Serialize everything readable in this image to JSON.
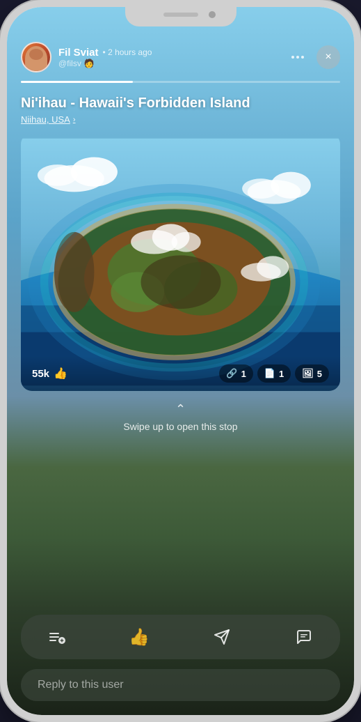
{
  "phone": {
    "notch": {
      "has_speaker": true,
      "has_camera": true
    }
  },
  "header": {
    "username": "Fil Sviat",
    "handle": "@filsv",
    "emoji": "🧑",
    "time_ago": "• 2 hours ago",
    "dots_label": "more options",
    "close_label": "×"
  },
  "progress": {
    "fill_percent": 35
  },
  "post": {
    "title": "Ni'ihau - Hawaii's Forbidden Island",
    "location": "Niihau, USA",
    "location_arrow": "›"
  },
  "image": {
    "alt": "Aerial view of Niihau island, Hawaii",
    "likes": "55k",
    "likes_icon": "👍",
    "pills": [
      {
        "count": "1",
        "icon": "🔗",
        "label": "link"
      },
      {
        "count": "1",
        "icon": "📄",
        "label": "document"
      },
      {
        "count": "5",
        "icon": "🖼",
        "label": "images"
      }
    ]
  },
  "swipe": {
    "chevron": "⌃",
    "text": "Swipe up to open this stop"
  },
  "action_bar": {
    "buttons": [
      {
        "id": "add-list",
        "icon": "≡+",
        "label": "add to list"
      },
      {
        "id": "like",
        "icon": "👍",
        "label": "like"
      },
      {
        "id": "share",
        "icon": "✈",
        "label": "share"
      },
      {
        "id": "comment",
        "icon": "💬",
        "label": "comment"
      }
    ]
  },
  "reply": {
    "placeholder": "Reply to this user"
  }
}
